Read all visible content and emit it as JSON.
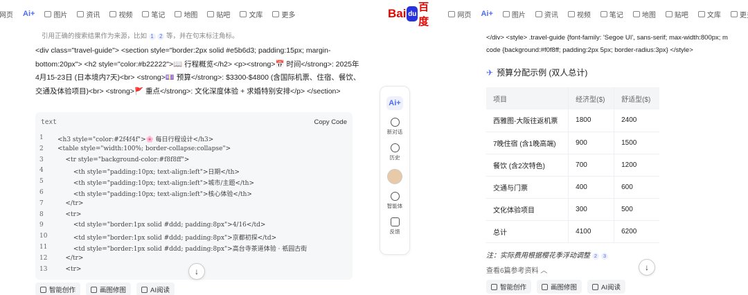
{
  "nav_left": {
    "items": [
      {
        "label": "网页",
        "active": false
      },
      {
        "label": "Ai+",
        "active": true
      },
      {
        "label": "图片",
        "active": false
      },
      {
        "label": "资讯",
        "active": false
      },
      {
        "label": "视频",
        "active": false
      },
      {
        "label": "笔记",
        "active": false
      },
      {
        "label": "地图",
        "active": false
      },
      {
        "label": "贴吧",
        "active": false
      },
      {
        "label": "文库",
        "active": false
      },
      {
        "label": "更多",
        "active": false
      }
    ]
  },
  "nav_right": {
    "logo": {
      "bai": "Bai",
      "paw": "du",
      "du": "百度"
    },
    "items": [
      {
        "label": "网页",
        "active": false
      },
      {
        "label": "Ai+",
        "active": true
      },
      {
        "label": "图片",
        "active": false
      },
      {
        "label": "资讯",
        "active": false
      },
      {
        "label": "视频",
        "active": false
      },
      {
        "label": "笔记",
        "active": false
      },
      {
        "label": "地图",
        "active": false
      },
      {
        "label": "贴吧",
        "active": false
      },
      {
        "label": "文库",
        "active": false
      },
      {
        "label": "更多",
        "active": false
      }
    ]
  },
  "left": {
    "cite_note": {
      "pre": "引用正确的搜索结果作为来源，比如",
      "n1": "1",
      "n2": "2",
      "post": "等，并在句末标注角标。"
    },
    "paragraph": "<div class=\"travel-guide\"> <section style=\"border:2px solid #e5b6d3; padding:15px; margin-bottom:20px\"> <h2 style=\"color:#b22222\">📖 行程概览</h2> <p><strong>📅 时间</strong>: 2025年4月15-23日 (日本境内7天)<br> <strong>💷 预算</strong>: $3300-$4800 (含国际机票、住宿、餐饮、交通及体验项目)<br> <strong>🚩 重点</strong>: 文化深度体验 + 求婚特别安排</p> </section>",
    "code": {
      "lang": "text",
      "copy_label": "Copy Code",
      "lines": [
        {
          "n": "1",
          "t": "<h3 style=\"color:#2f4f4f\">🌸 每日行程设计</h3>"
        },
        {
          "n": "2",
          "t": "<table style=\"width:100%; border-collapse:collapse\">"
        },
        {
          "n": "3",
          "t": "    <tr style=\"background-color:#f8f8ff\">"
        },
        {
          "n": "4",
          "t": "        <th style=\"padding:10px; text-align:left\">日期</th>"
        },
        {
          "n": "5",
          "t": "        <th style=\"padding:10px; text-align:left\">城市/主题</th>"
        },
        {
          "n": "6",
          "t": "        <th style=\"padding:10px; text-align:left\">核心体验</th>"
        },
        {
          "n": "7",
          "t": "    </tr>"
        },
        {
          "n": "8",
          "t": "    <tr>"
        },
        {
          "n": "9",
          "t": "        <td style=\"border:1px solid #ddd; padding:8px\">4/16</td>"
        },
        {
          "n": "10",
          "t": "        <td style=\"border:1px solid #ddd; padding:8px\">京都初探</td>"
        },
        {
          "n": "11",
          "t": "        <td style=\"border:1px solid #ddd; padding:8px\">高台寺茶道体验 · 祇园古街"
        },
        {
          "n": "12",
          "t": "    </tr>"
        },
        {
          "n": "13",
          "t": "    <tr>"
        }
      ]
    },
    "tools": [
      "智能创作",
      "画图修图",
      "AI阅读"
    ]
  },
  "sidebar": {
    "ai_label": "Ai+",
    "items": [
      {
        "label": "新对话",
        "icon": "new-chat-icon"
      },
      {
        "label": "历史",
        "icon": "history-icon"
      },
      {
        "label": "智能体",
        "icon": "agent-icon"
      },
      {
        "label": "反馈",
        "icon": "feedback-icon"
      }
    ]
  },
  "right": {
    "code_lines": [
      "</div> <style> .travel-guide {font-family: 'Segoe UI', sans-serif; max-width:800px; m",
      "code {background:#f0f8ff; padding:2px 5px; border-radius:3px} </style>"
    ],
    "title_emoji": "✈",
    "title": "预算分配示例 (双人总计)",
    "table": {
      "headers": [
        "项目",
        "经济型($)",
        "舒适型($)"
      ],
      "rows": [
        [
          "西雅图-大阪往返机票",
          "1800",
          "2400"
        ],
        [
          "7晚住宿 (含1晚高端)",
          "900",
          "1500"
        ],
        [
          "餐饮 (含2次特色)",
          "700",
          "1200"
        ],
        [
          "交通与门票",
          "400",
          "600"
        ],
        [
          "文化体验项目",
          "300",
          "500"
        ],
        [
          "总计",
          "4100",
          "6200"
        ]
      ]
    },
    "note": {
      "text": "注：实际费用根据樱花季浮动调整",
      "n1": "2",
      "n2": "3"
    },
    "refs": "查看6篇参考资料 ︿",
    "tools": [
      "智能创作",
      "画图修图",
      "AI阅读"
    ]
  },
  "scroll_glyph": "↓"
}
